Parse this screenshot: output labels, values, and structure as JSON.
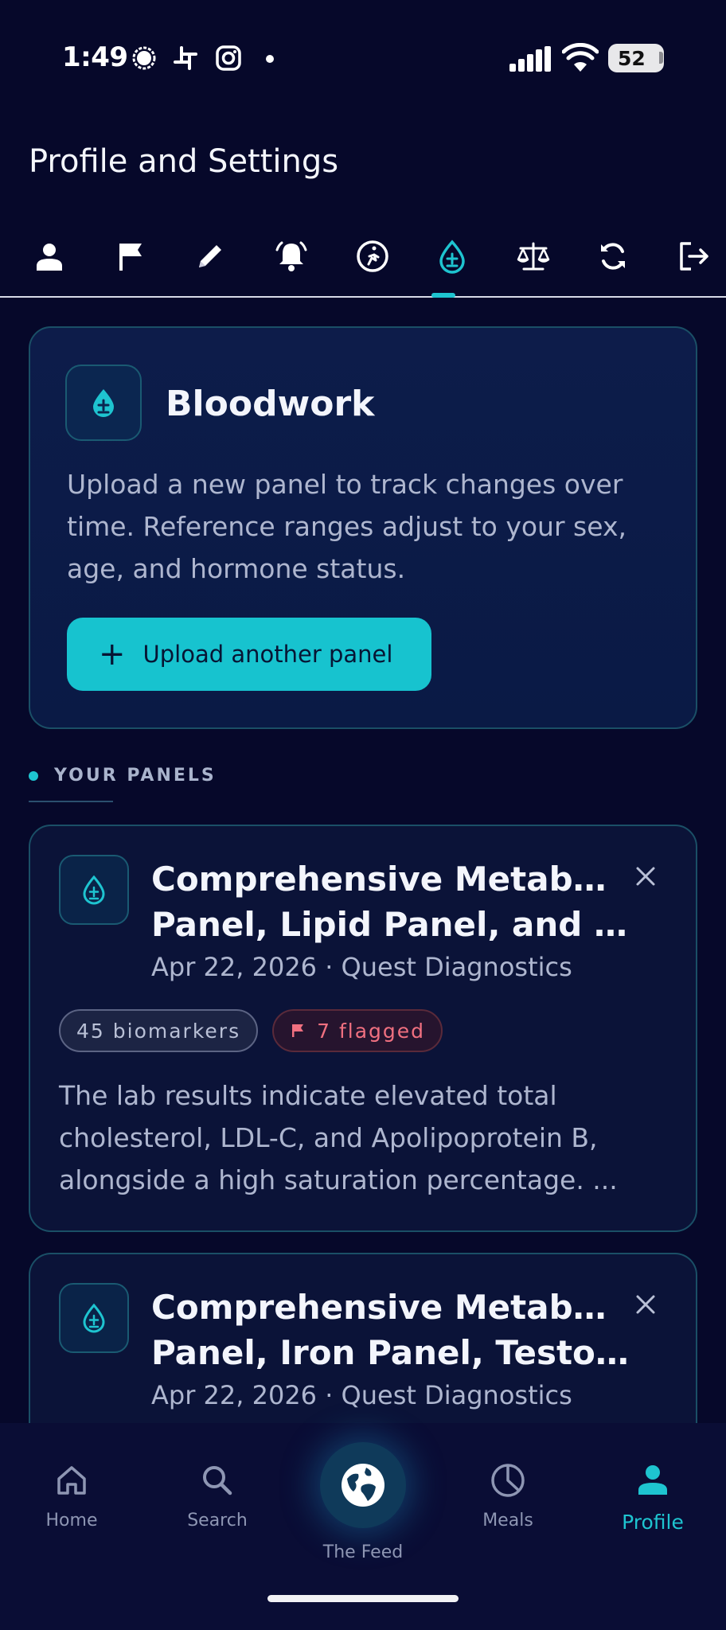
{
  "status_bar": {
    "time": "1:49",
    "battery": "52"
  },
  "header": {
    "title": "Profile and Settings"
  },
  "tabs": [
    {
      "icon": "user-icon"
    },
    {
      "icon": "flag-icon"
    },
    {
      "icon": "pencil-icon"
    },
    {
      "icon": "bell-icon"
    },
    {
      "icon": "activity-icon"
    },
    {
      "icon": "blood-drop-icon",
      "active": true
    },
    {
      "icon": "scale-icon"
    },
    {
      "icon": "sync-icon"
    },
    {
      "icon": "logout-icon"
    }
  ],
  "hero": {
    "title": "Bloodwork",
    "description": "Upload a new panel to track changes over time. Reference ranges adjust to your sex, age, and hormone status.",
    "upload_button": "Upload another panel"
  },
  "section": {
    "label": "YOUR PANELS"
  },
  "panels": [
    {
      "title_line1": "Comprehensive Metabolic",
      "title_line2": "Panel, Lipid Panel, and va...",
      "meta": "Apr 22, 2026 · Quest Diagnostics",
      "biomarkers": "45 biomarkers",
      "flagged": "7 flagged",
      "summary": "The lab results indicate elevated total cholesterol, LDL-C, and Apolipoprotein B, alongside a high saturation percentage. ..."
    },
    {
      "title_line1": "Comprehensive Metabolic",
      "title_line2": "Panel, Iron Panel, Testost...",
      "meta": "Apr 22, 2026 · Quest Diagnostics"
    }
  ],
  "bottom_nav": {
    "home": "Home",
    "search": "Search",
    "feed": "The Feed",
    "meals": "Meals",
    "profile": "Profile"
  },
  "colors": {
    "accent": "#1ec4d0",
    "background": "#06082a",
    "flag": "#f07080"
  }
}
